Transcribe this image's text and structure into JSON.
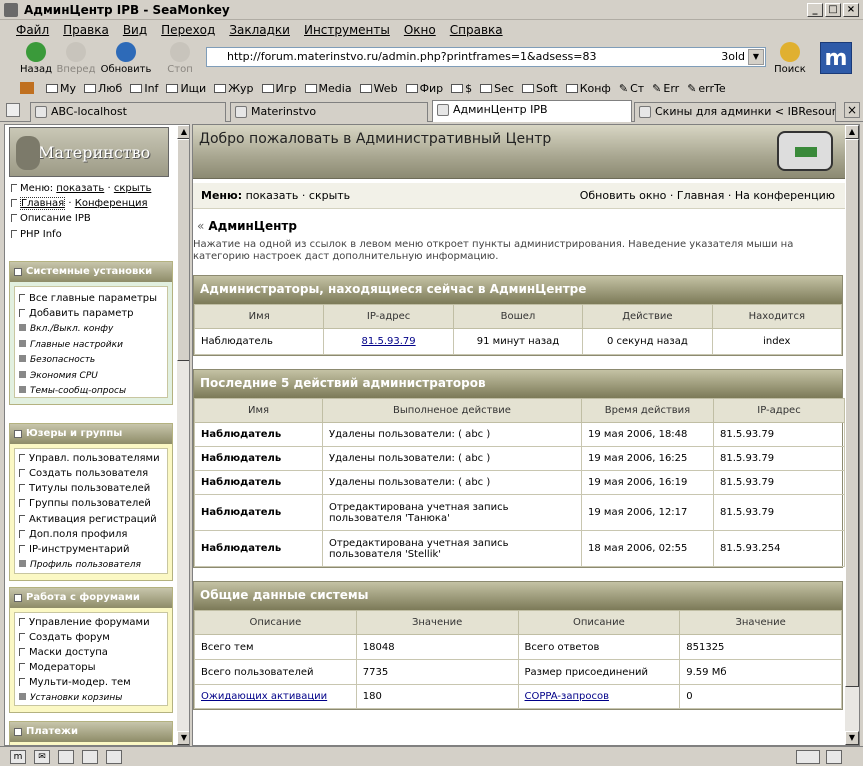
{
  "window": {
    "title": "АдминЦентр IPB - SeaMonkey"
  },
  "menu": [
    "Файл",
    "Правка",
    "Вид",
    "Переход",
    "Закладки",
    "Инструменты",
    "Окно",
    "Справка"
  ],
  "nav": {
    "back": "Назад",
    "forward": "Вперед",
    "reload": "Обновить",
    "stop": "Стоп",
    "search": "Поиск",
    "url": "http://forum.materinstvo.ru/admin.php?printframes=1&adsess=83",
    "url_tail": "3old"
  },
  "bookmarks": [
    "My",
    "Люб",
    "Inf",
    "Ищи",
    "Жур",
    "Игр",
    "Media",
    "Web",
    "Фир",
    "$",
    "Sec",
    "Soft",
    "Конф",
    "Ст",
    "Err",
    "errTe"
  ],
  "tabs": [
    "ABC-localhost",
    "Materinstvo",
    "АдминЦентр IPB",
    "Скины для админки < IBResour..."
  ],
  "left": {
    "logo_text": "Материнство",
    "menu_label": "Меню:",
    "menu_show": "показать",
    "menu_hide": "скрыть",
    "link_main": "Главная",
    "link_conf": "Конференция",
    "link_ipb": "Описание IPB",
    "link_php": "PHP Info",
    "sections": [
      {
        "title": "Системные установки",
        "items": [
          "Все главные параметры",
          "Добавить параметр",
          "Вкл./Выкл. конфу",
          "Главные настройки",
          "Безопасность",
          "Экономия CPU",
          "Темы-сообщ-опросы"
        ]
      },
      {
        "title": "Юзеры и группы",
        "items": [
          "Управл. пользователями",
          "Создать пользователя",
          "Титулы пользователей",
          "Группы пользователей",
          "Активация регистраций",
          "Доп.поля профиля",
          "IP-инструментарий",
          "Профиль пользователя"
        ]
      },
      {
        "title": "Работа с форумами",
        "items": [
          "Управление форумами",
          "Создать форум",
          "Маски доступа",
          "Модераторы",
          "Мульти-модер. тем",
          "Установки корзины"
        ]
      },
      {
        "title": "Платежи",
        "items": []
      }
    ]
  },
  "right": {
    "header_title": "Добро пожаловать в Административный Центр",
    "menu_label": "Меню:",
    "menu_show": "показать",
    "menu_hide": "скрыть",
    "links": "Обновить окно · Главная · На конференцию",
    "section_title": "АдминЦентр",
    "section_desc": "Нажатие на одной из ссылок в левом меню откроет пункты администрирования. Наведение указателя мыши на категорию настроек даст дополнительную информацию.",
    "admins": {
      "title": "Администраторы, находящиеся сейчас в АдминЦентре",
      "headers": [
        "Имя",
        "IP-адрес",
        "Вошел",
        "Действие",
        "Находится"
      ],
      "rows": [
        [
          "Наблюдатель",
          "81.5.93.79",
          "91 минут назад",
          "0 секунд назад",
          "index"
        ]
      ]
    },
    "actions": {
      "title": "Последние 5 действий администраторов",
      "headers": [
        "Имя",
        "Выполненое действие",
        "Время действия",
        "IP-адрес"
      ],
      "rows": [
        [
          "Наблюдатель",
          "Удалены пользователи: ( abc )",
          "",
          "19 мая 2006, 18:48",
          "81.5.93.79"
        ],
        [
          "Наблюдатель",
          "Удалены пользователи: ( abc )",
          "",
          "19 мая 2006, 16:25",
          "81.5.93.79"
        ],
        [
          "Наблюдатель",
          "Удалены пользователи: ( abc )",
          "",
          "19 мая 2006, 16:19",
          "81.5.93.79"
        ],
        [
          "Наблюдатель",
          "Отредактирована учетная запись",
          "пользователя 'Танюка'",
          "19 мая 2006, 12:17",
          "81.5.93.79"
        ],
        [
          "Наблюдатель",
          "Отредактирована учетная запись",
          "пользователя 'Stellik'",
          "18 мая 2006, 02:55",
          "81.5.93.254"
        ]
      ]
    },
    "stats": {
      "title": "Общие данные системы",
      "headers": [
        "Описание",
        "Значение",
        "Описание",
        "Значение"
      ],
      "rows": [
        [
          "Всего тем",
          "18048",
          "Всего ответов",
          "851325"
        ],
        [
          "Всего пользователей",
          "7735",
          "Размер присоединений",
          "9.59 Мб"
        ],
        [
          "Ожидающих активации",
          "180",
          "COPPA-запросов",
          "0"
        ]
      ]
    }
  }
}
